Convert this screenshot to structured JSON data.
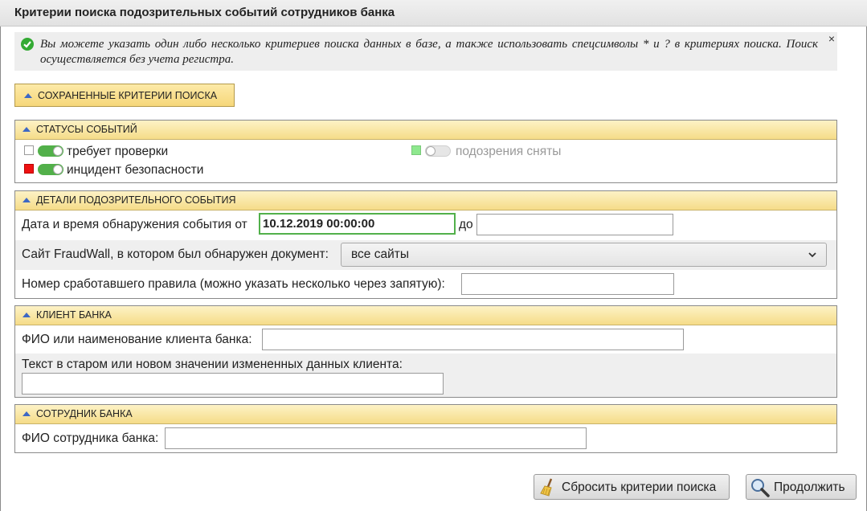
{
  "title": "Критерии поиска подозрительных событий сотрудников банка",
  "info": {
    "text": "Вы можете указать один либо несколько критериев поиска данных в базе, а также использовать спецсимволы * и ? в критериях поиска. Поиск осуществляется без учета регистра.",
    "close": "×"
  },
  "saved_criteria": {
    "label": "СОХРАНЕННЫЕ КРИТЕРИИ ПОИСКА"
  },
  "statuses": {
    "header": "СТАТУСЫ СОБЫТИЙ",
    "items": [
      {
        "label": "требует проверки",
        "color": "#ffffff",
        "enabled": true
      },
      {
        "label": "подозрения сняты",
        "color": "#8ee88e",
        "enabled": false
      },
      {
        "label": "инцидент безопасности",
        "color": "#ee1111",
        "enabled": true
      }
    ]
  },
  "details": {
    "header": "ДЕТАЛИ ПОДОЗРИТЕЛЬНОГО СОБЫТИЯ",
    "date_label": "Дата и время обнаружения события от",
    "date_from": "10.12.2019 00:00:00",
    "date_to_label": "до",
    "date_to": "",
    "site_label": "Сайт FraudWall, в котором был обнаружен документ:",
    "site_value": "все сайты",
    "rule_label": "Номер сработавшего правила (можно указать несколько через запятую):",
    "rule_value": ""
  },
  "client": {
    "header": "КЛИЕНТ БАНКА",
    "name_label": "ФИО или наименование клиента банка:",
    "name_value": "",
    "text_label": "Текст в старом или новом значении измененных данных клиента:",
    "text_value": ""
  },
  "employee": {
    "header": "СОТРУДНИК БАНКА",
    "name_label": "ФИО сотрудника банка:",
    "name_value": ""
  },
  "actions": {
    "reset_label": "Сбросить критерии поиска",
    "continue_label": "Продолжить"
  },
  "colors": {
    "accent_green": "#52b04a",
    "header_gold": "#f5dc88"
  }
}
